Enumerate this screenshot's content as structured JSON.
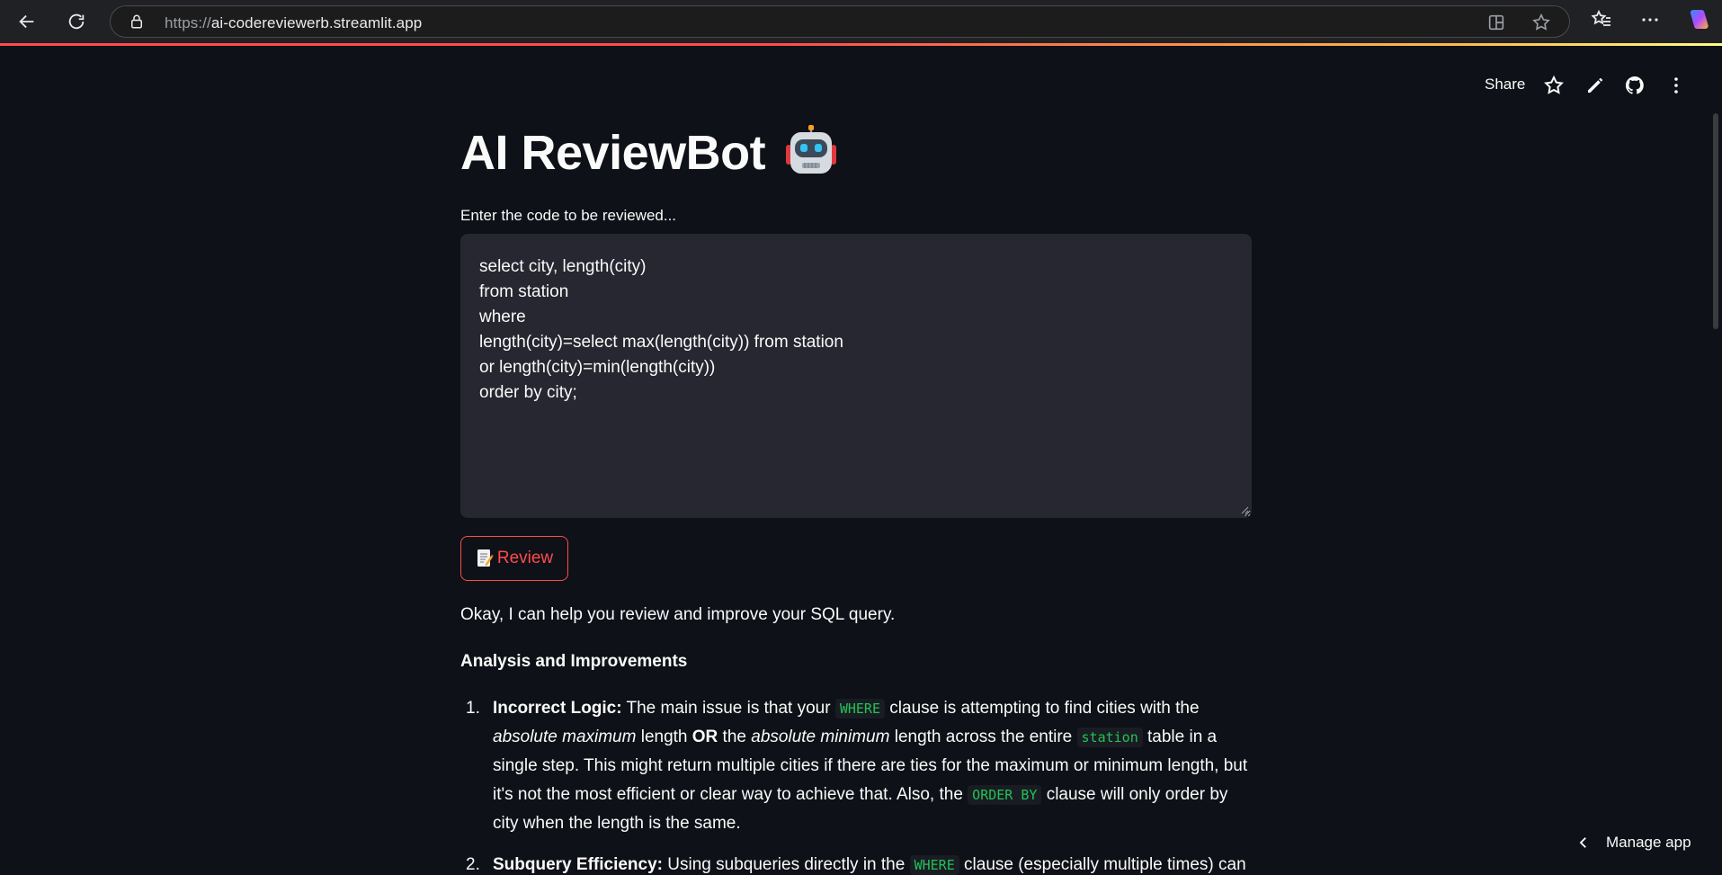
{
  "browser": {
    "url_protocol": "https://",
    "url_host": "ai-codereviewerb.streamlit.app",
    "icons": [
      "back-icon",
      "reload-icon",
      "lock-icon",
      "split-screen-icon",
      "star-icon",
      "favorites-icon",
      "more-icon",
      "copilot-icon"
    ]
  },
  "toolbar": {
    "share_label": "Share"
  },
  "app": {
    "title": "AI ReviewBot",
    "input_label": "Enter the code to be reviewed...",
    "code_value": "select city, length(city)\nfrom station\nwhere\nlength(city)=select max(length(city)) from station\nor length(city)=min(length(city))\norder by city;",
    "review_button_label": "Review"
  },
  "response": {
    "intro": "Okay, I can help you review and improve your SQL query.",
    "heading": "Analysis and Improvements",
    "items": [
      {
        "num": "1.",
        "bold_lead": "Incorrect Logic:",
        "t1": " The main issue is that your ",
        "c1": "WHERE",
        "t2": " clause is attempting to find cities with the ",
        "i1": "absolute maximum",
        "t3": " length ",
        "b2": "OR",
        "t4": " the ",
        "i2": "absolute minimum",
        "t5": " length across the entire ",
        "c2": "station",
        "t6": " table in a single step. This might return multiple cities if there are ties for the maximum or minimum length, but it's not the most efficient or clear way to achieve that. Also, the ",
        "c3": "ORDER BY",
        "t7": " clause will only order by city when the length is the same."
      },
      {
        "num": "2.",
        "bold_lead": "Subquery Efficiency:",
        "t1": " Using subqueries directly in the ",
        "c1": "WHERE",
        "t2": " clause (especially multiple times) can"
      }
    ]
  },
  "footer": {
    "manage_app_label": "Manage app"
  },
  "colors": {
    "background": "#0e1117",
    "accent": "#ff4b4b",
    "code_green": "#21c354",
    "textarea_bg": "#262730"
  }
}
